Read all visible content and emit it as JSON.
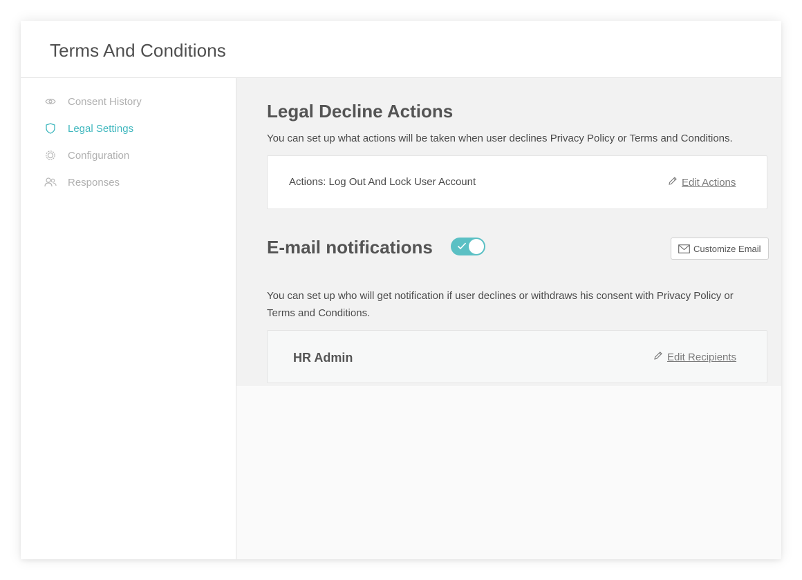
{
  "header": {
    "title": "Terms And Conditions"
  },
  "sidebar": {
    "items": [
      {
        "label": "Consent History",
        "icon": "eye-icon",
        "active": false
      },
      {
        "label": "Legal Settings",
        "icon": "shield-icon",
        "active": true
      },
      {
        "label": "Configuration",
        "icon": "gear-icon",
        "active": false
      },
      {
        "label": "Responses",
        "icon": "users-icon",
        "active": false
      }
    ]
  },
  "legal_decline": {
    "title": "Legal Decline Actions",
    "description": "You can set up what actions will be taken when user declines Privacy Policy or Terms and Conditions.",
    "actions_text": "Actions: Log Out And Lock User Account",
    "edit_label": "Edit Actions"
  },
  "email_notifications": {
    "title": "E-mail notifications",
    "enabled": true,
    "customize_label": "Customize Email",
    "description": "You can set up who will get notification if user declines or withdraws his consent with Privacy Policy or Terms and Conditions.",
    "recipient": "HR Admin",
    "edit_label": "Edit Recipients"
  },
  "colors": {
    "accent": "#3fb7be",
    "toggle_on": "#5bc0c4",
    "panel_bg": "#f2f2f2",
    "muted_text": "#b0b0b0"
  }
}
